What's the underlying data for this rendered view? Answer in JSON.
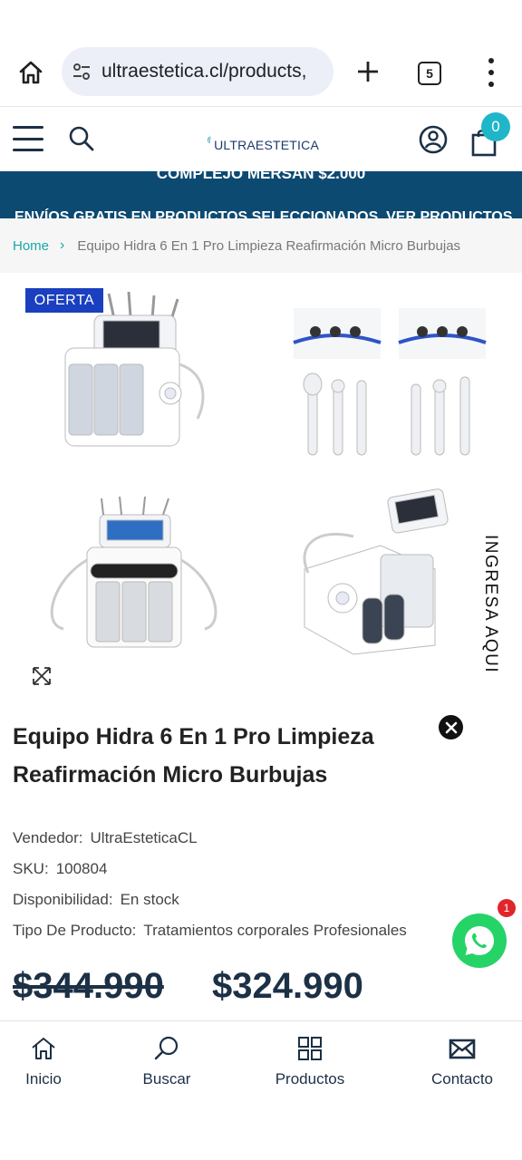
{
  "browser": {
    "url": "ultraestetica.cl/products,",
    "tab_count": "5"
  },
  "header": {
    "logo_text": "ULTRAESTETICA",
    "cart_count": "0"
  },
  "announcement": {
    "line1": "COMPLEJO MERSAN $2.000",
    "line2": "ENVÍOS GRATIS EN PRODUCTOS SELECCIONADOS. VER PRODUCTOS"
  },
  "breadcrumb": {
    "home": "Home",
    "current": "Equipo Hidra 6 En 1 Pro Limpieza Reafirmación Micro Burbujas"
  },
  "gallery": {
    "badge": "OFERTA",
    "side_tab": "INGRESA AQUI"
  },
  "product": {
    "title": "Equipo Hidra 6 En 1 Pro Limpieza Reafirmación Micro Burbujas",
    "vendor_label": "Vendedor:",
    "vendor": "UltraEsteticaCL",
    "sku_label": "SKU:",
    "sku": "100804",
    "availability_label": "Disponibilidad:",
    "availability": "En stock",
    "type_label": "Tipo De Producto:",
    "type": "Tratamientos corporales Profesionales",
    "price_old": "$344.990",
    "price_new": "$324.990"
  },
  "whatsapp": {
    "badge": "1"
  },
  "bottom_nav": {
    "home": "Inicio",
    "search": "Buscar",
    "products": "Productos",
    "contact": "Contacto"
  },
  "colors": {
    "navy": "#1c3046",
    "announce_bg": "#0c4a72",
    "teal": "#1aa7a8",
    "badge_blue": "#1a3fbf",
    "whatsapp": "#25d366"
  }
}
